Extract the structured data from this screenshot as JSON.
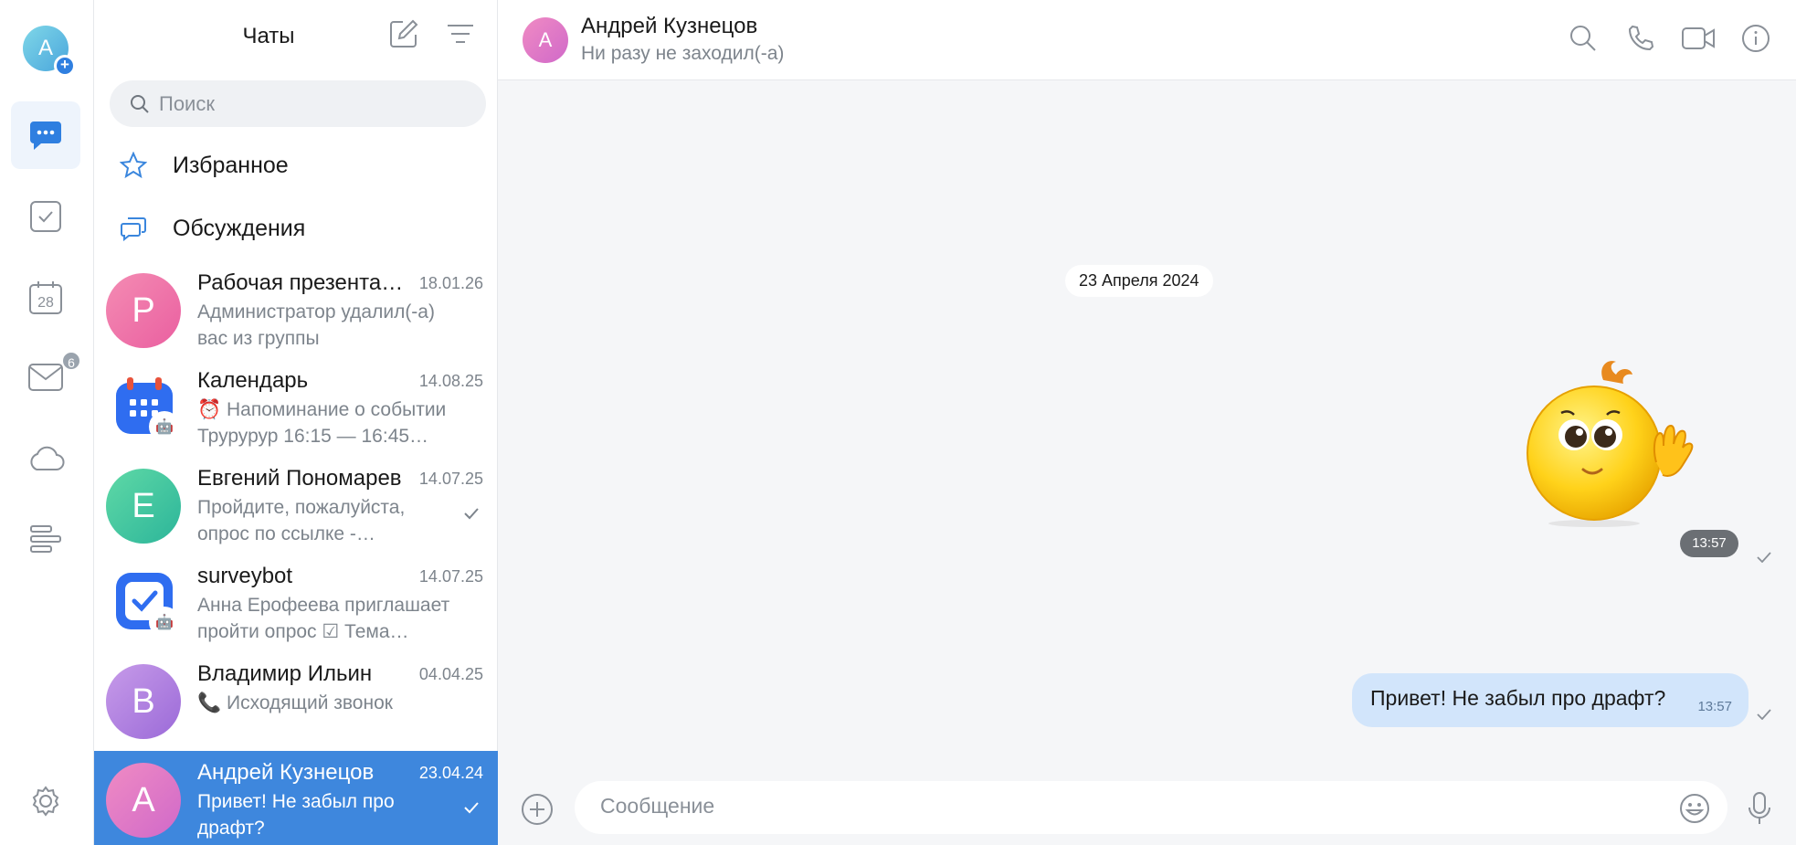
{
  "rail": {
    "avatar_letter": "А",
    "mail_badge": "6",
    "calendar_day": "28"
  },
  "list": {
    "title": "Чаты",
    "search_placeholder": "Поиск",
    "favorites_label": "Избранное",
    "discussions_label": "Обсуждения",
    "chats": [
      {
        "name": "Рабочая презентация",
        "date": "18.01.26",
        "preview": "Администратор удалил(-а) вас из группы",
        "avatar_letter": "Р",
        "avatar_color": "#ef6fa4",
        "read": false
      },
      {
        "name": "Календарь",
        "date": "14.08.25",
        "preview": "⏰ Напоминание о событии Трурурур 16:15 — 16:45…",
        "avatar_letter": "",
        "avatar_color": "#2f6df0",
        "read": false
      },
      {
        "name": "Евгений Пономарев",
        "date": "14.07.25",
        "preview": "Пройдите, пожалуйста, опрос по ссылке -…",
        "avatar_letter": "Е",
        "avatar_color": "#3cc49a",
        "read": true
      },
      {
        "name": "surveybot",
        "date": "14.07.25",
        "preview": "Анна Ерофеева приглашает пройти опрос ☑ Тема…",
        "avatar_letter": "",
        "avatar_color": "#2f6df0",
        "read": false
      },
      {
        "name": "Владимир Ильин",
        "date": "04.04.25",
        "preview": "📞 Исходящий звонок",
        "avatar_letter": "В",
        "avatar_color": "#b07fe0",
        "read": false
      },
      {
        "name": "Андрей Кузнецов",
        "date": "23.04.24",
        "preview": "Привет! Не забыл про драфт?",
        "avatar_letter": "А",
        "avatar_color": "#e274c8",
        "read": true
      }
    ]
  },
  "conversation": {
    "avatar_letter": "А",
    "title": "Андрей Кузнецов",
    "subtitle": "Ни разу не заходил(-а)",
    "date_chip": "23 Апреля 2024",
    "sticker_time": "13:57",
    "message_text": "Привет! Не забыл про драфт?",
    "message_time": "13:57",
    "composer_placeholder": "Сообщение"
  },
  "colors": {
    "accent": "#3e87dd",
    "bubble": "#d2e5fb",
    "background": "#f5f6f8"
  }
}
